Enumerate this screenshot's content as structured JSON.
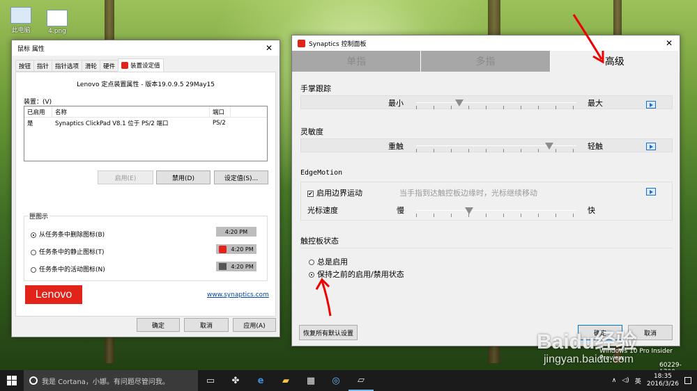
{
  "desktop": {
    "icons": [
      {
        "label": "此电脑",
        "icon": "computer-icon"
      },
      {
        "label": "4.png",
        "icon": "image-file-icon"
      }
    ],
    "watermark": {
      "baidu": "Baidu经验",
      "url": "jingyan.baidu.com"
    },
    "win_build_text": "Windows 10 Pro Insider Preview",
    "win_build_num": "60229-1700"
  },
  "mouse_props": {
    "title": "鼠标 属性",
    "tabs": [
      "按钮",
      "指针",
      "指针选项",
      "滑轮",
      "硬件",
      "装置设定值"
    ],
    "header": "Lenovo 定点装置属性 - 版本19.0.9.5 29May15",
    "devices_label": "装置：(V)",
    "columns": [
      "已启用",
      "名称",
      "端口"
    ],
    "rows": [
      {
        "enabled": "是",
        "name": "Synaptics ClickPad V8.1 位于 PS/2 端口",
        "port": "PS/2"
      }
    ],
    "btn_enable": "启用(E)",
    "btn_disable": "禁用(D)",
    "btn_settings": "设定值(S)...",
    "group_title": "匣图示",
    "radios": [
      {
        "label": "从任务条中删除图标(B)",
        "checked": true,
        "time": "4:20 PM"
      },
      {
        "label": "任务条中的静止图标(T)",
        "checked": false,
        "time": "4:20 PM"
      },
      {
        "label": "任务条中的活动图标(N)",
        "checked": false,
        "time": "4:20 PM"
      }
    ],
    "logo": "Lenovo",
    "link": "www.synaptics.com",
    "btn_ok": "确定",
    "btn_cancel": "取消",
    "btn_apply": "应用(A)",
    "accent": "#e2231a"
  },
  "synaptics": {
    "title": "Synaptics 控制面板",
    "tabs": [
      "单指",
      "多指",
      "高级"
    ],
    "palm": {
      "title": "手掌跟踪",
      "min": "最小",
      "max": "最大",
      "level": 0.27
    },
    "sens": {
      "title": "灵敏度",
      "min": "重触",
      "max": "轻触",
      "level": 0.83
    },
    "edge": {
      "title": "EdgeMotion",
      "checkbox": "启用边界运动",
      "desc": "当手指到达触控板边缘时，光标继续移动",
      "speed": "光标速度",
      "slow": "慢",
      "fast": "快",
      "level": 0.33
    },
    "state": {
      "title": "触控板状态",
      "opt1": "总是启用",
      "opt2": "保持之前的启用/禁用状态"
    },
    "btn_restore": "恢复所有默认设置",
    "btn_ok": "确定",
    "btn_cancel": "取消"
  },
  "taskbar": {
    "cortana": "我是 Cortana，小娜。有问题尽管问我。",
    "lang": "英",
    "time": "18:35",
    "date": "2016/3/26"
  }
}
